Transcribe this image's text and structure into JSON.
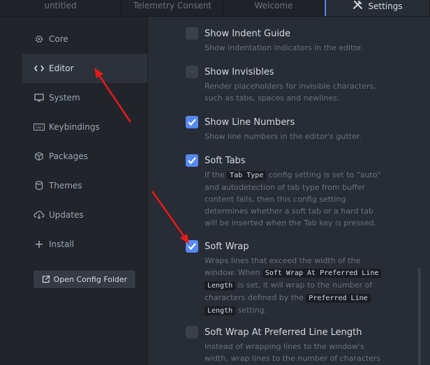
{
  "tabs": [
    {
      "label": "untitled"
    },
    {
      "label": "Telemetry Consent"
    },
    {
      "label": "Welcome"
    },
    {
      "label": "Settings"
    }
  ],
  "sidebar": {
    "items": [
      {
        "label": "Core",
        "icon": "settings-gear-icon"
      },
      {
        "label": "Editor",
        "icon": "code-icon"
      },
      {
        "label": "System",
        "icon": "monitor-icon"
      },
      {
        "label": "Keybindings",
        "icon": "keyboard-icon"
      },
      {
        "label": "Packages",
        "icon": "package-icon"
      },
      {
        "label": "Themes",
        "icon": "paintcan-icon"
      },
      {
        "label": "Updates",
        "icon": "cloud-download-icon"
      },
      {
        "label": "Install",
        "icon": "plus-icon"
      }
    ],
    "open_config_label": "Open Config Folder"
  },
  "settings": [
    {
      "title": "Show Indent Guide",
      "checked": false,
      "desc": "Show indentation indicators in the editor."
    },
    {
      "title": "Show Invisibles",
      "checked": false,
      "desc": [
        "Render placeholders for invisible characters,",
        "such as tabs, spaces and newlines."
      ]
    },
    {
      "title": "Show Line Numbers",
      "checked": true,
      "desc": "Show line numbers in the editor's gutter."
    },
    {
      "title": "Soft Tabs",
      "checked": true,
      "desc_parts": {
        "p1": "If the ",
        "c1": "Tab Type",
        "p2": " config setting is set to \"auto\"",
        "l2": "and autodetection of tab type from buffer",
        "l3": "content fails, then this config setting",
        "l4": "determines whether a soft tab or a hard tab",
        "l5": "will be inserted when the Tab key is pressed."
      }
    },
    {
      "title": "Soft Wrap",
      "checked": true,
      "desc_parts": {
        "l1": "Wraps lines that exceed the width of the",
        "p1": "window. When ",
        "c1": "Soft Wrap At Preferred Line",
        "c2": "Length",
        "p2": " is set, it will wrap to the number of",
        "p3": "characters defined by the ",
        "c3": "Preferred Line",
        "c4": "Length",
        "p4": " setting."
      }
    },
    {
      "title": "Soft Wrap At Preferred Line Length",
      "checked": false,
      "desc": [
        "Instead of wrapping lines to the window's",
        "width, wrap lines to the number of characters"
      ]
    }
  ],
  "colors": {
    "accent": "#568af2",
    "annotation": "#e8191a"
  }
}
